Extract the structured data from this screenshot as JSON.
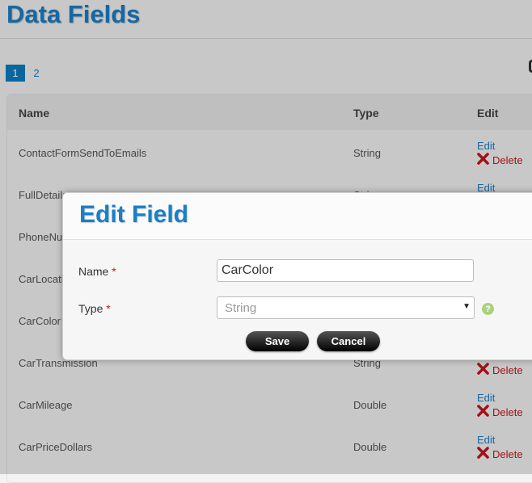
{
  "page": {
    "title": "Data Fields"
  },
  "pagination": {
    "pages": [
      "1",
      "2"
    ],
    "active": "1"
  },
  "table": {
    "headers": {
      "name": "Name",
      "type": "Type",
      "edit": "Edit"
    },
    "edit_label": "Edit",
    "delete_label": "Delete",
    "rows": [
      {
        "name": "ContactFormSendToEmails",
        "type": "String"
      },
      {
        "name": "FullDetails",
        "type": "String"
      },
      {
        "name": "PhoneNumber",
        "type": ""
      },
      {
        "name": "CarLocation",
        "type": ""
      },
      {
        "name": "CarColor",
        "type": ""
      },
      {
        "name": "CarTransmission",
        "type": "String"
      },
      {
        "name": "CarMileage",
        "type": "Double"
      },
      {
        "name": "CarPriceDollars",
        "type": "Double"
      }
    ]
  },
  "modal": {
    "title": "Edit Field",
    "name_label": "Name",
    "name_value": "CarColor",
    "type_label": "Type",
    "type_value": "String",
    "required_marker": "*",
    "help_glyph": "?",
    "save_label": "Save",
    "cancel_label": "Cancel"
  },
  "colors": {
    "accent": "#1a7fc6",
    "delete": "#c4161c",
    "help": "#a9d27a"
  }
}
